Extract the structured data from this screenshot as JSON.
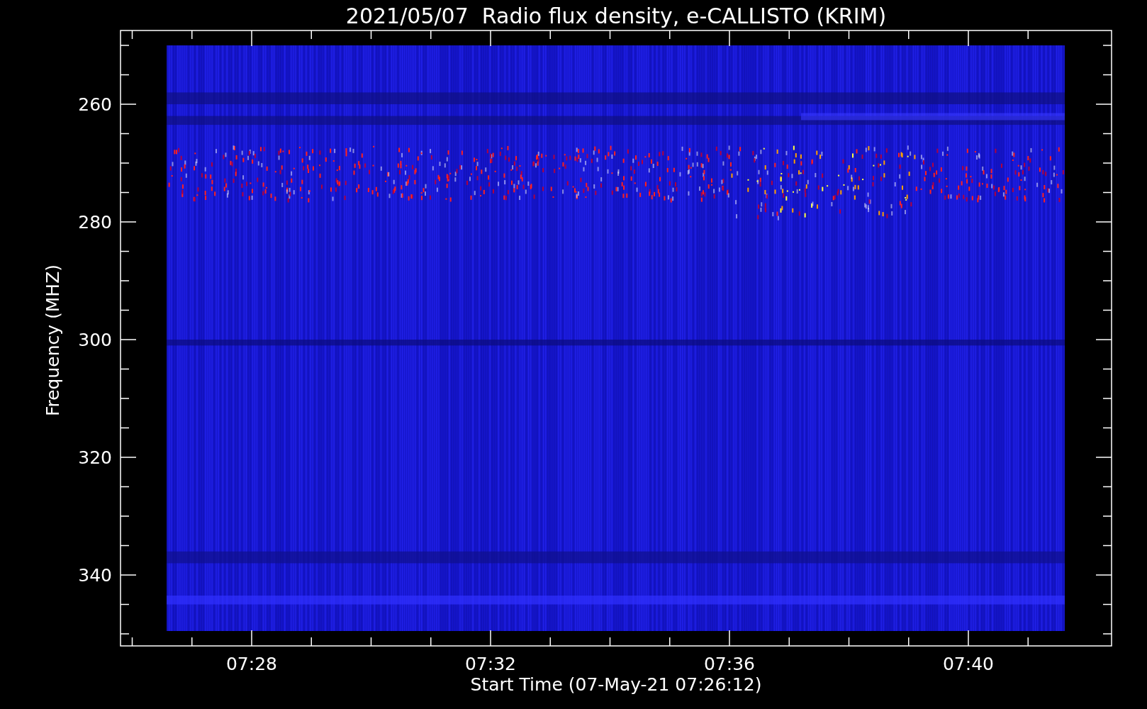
{
  "title": "2021/05/07  Radio flux density, e-CALLISTO (KRIM)",
  "y_axis": {
    "label": "Frequency (MHZ)",
    "ticks": [
      "260",
      "280",
      "300",
      "320",
      "340"
    ]
  },
  "x_axis": {
    "label": "Start Time (07-May-21 07:26:12)",
    "ticks": [
      "07:28",
      "07:32",
      "07:36",
      "07:40"
    ]
  }
}
